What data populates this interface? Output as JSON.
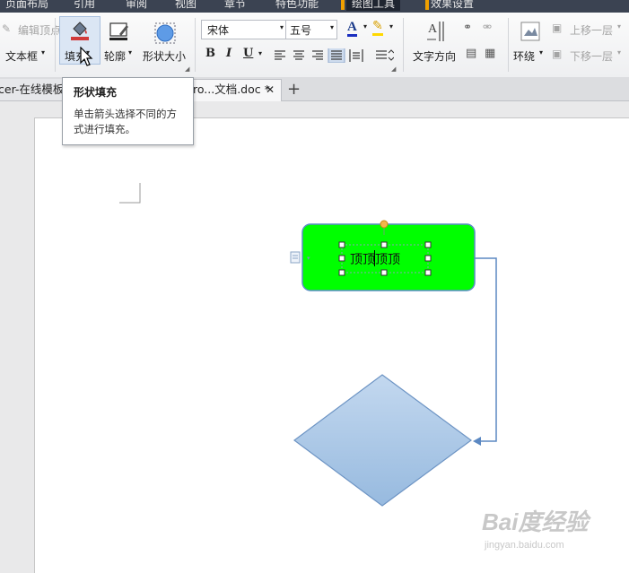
{
  "menu": {
    "items": [
      "页面布局",
      "引用",
      "审阅",
      "视图",
      "章节",
      "特色功能",
      "绘图工具",
      "效果设置"
    ]
  },
  "ribbon": {
    "edit_vertices": "编辑顶点",
    "text_box": "文本框",
    "fill": "填充",
    "outline": "轮廓",
    "shape_size": "形状大小",
    "font_name": "宋体",
    "font_size": "五号",
    "font_color_letter": "A",
    "bold": "B",
    "italic": "I",
    "underline": "U",
    "text_direction": "文字方向",
    "wrap": "环绕",
    "bring_forward": "上移一层",
    "send_backward": "下移一层"
  },
  "tabs": {
    "tab1": "cer-在线模板",
    "tab2": "ro...文档.doc *",
    "close": "✕",
    "add": "+"
  },
  "tooltip": {
    "title": "形状填充",
    "body": "单击箭头选择不同的方式进行填充。"
  },
  "canvas": {
    "shape_text": "顶顶顶顶"
  },
  "watermark": {
    "brand": "Bai度经验",
    "url": "jingyan.baidu.com"
  },
  "colors": {
    "accent_orange": "#f0a000",
    "green_shape": "#00ff00",
    "diamond_fill": "#a9c7e8"
  }
}
